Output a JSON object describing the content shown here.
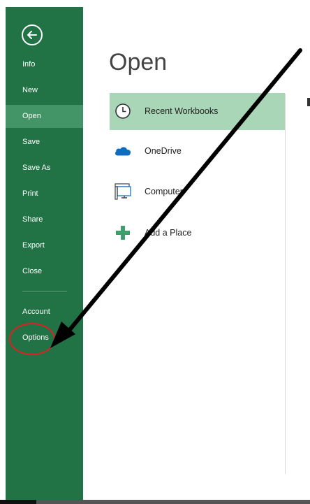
{
  "sidebar": {
    "back_label": "Back",
    "items": [
      {
        "label": "Info",
        "active": false
      },
      {
        "label": "New",
        "active": false
      },
      {
        "label": "Open",
        "active": true
      },
      {
        "label": "Save",
        "active": false
      },
      {
        "label": "Save As",
        "active": false
      },
      {
        "label": "Print",
        "active": false
      },
      {
        "label": "Share",
        "active": false
      },
      {
        "label": "Export",
        "active": false
      },
      {
        "label": "Close",
        "active": false
      }
    ],
    "bottom_items": [
      {
        "label": "Account"
      },
      {
        "label": "Options"
      }
    ]
  },
  "main": {
    "title": "Open",
    "locations": [
      {
        "label": "Recent Workbooks",
        "icon": "clock-icon",
        "active": true
      },
      {
        "label": "OneDrive",
        "icon": "cloud-icon",
        "active": false
      },
      {
        "label": "Computer",
        "icon": "computer-icon",
        "active": false
      },
      {
        "label": "Add a Place",
        "icon": "plus-icon",
        "active": false
      }
    ]
  },
  "colors": {
    "sidebar": "#217346",
    "sidebar_active": "#439467",
    "location_active": "#a8d6b7",
    "annotation_circle": "#e02020",
    "annotation_arrow": "#000000"
  }
}
